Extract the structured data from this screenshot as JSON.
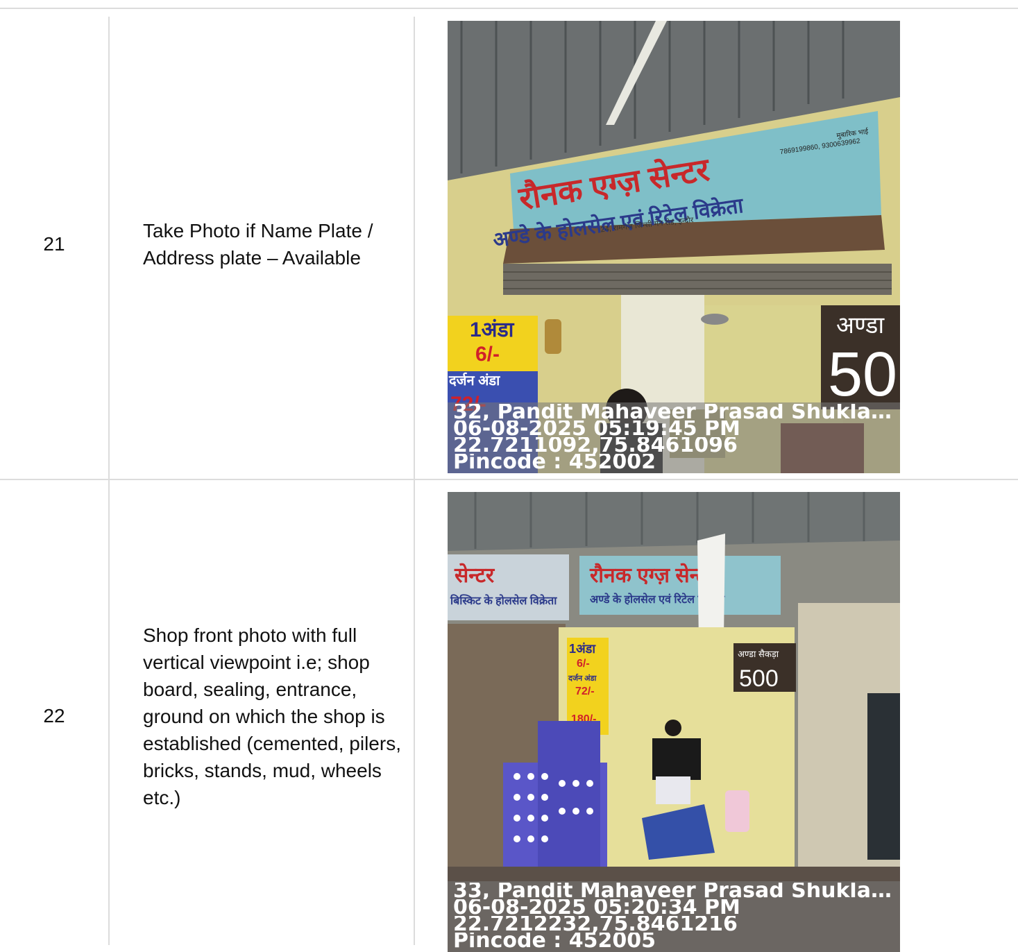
{
  "rows": [
    {
      "number": "21",
      "description": "Take Photo if Name Plate / Address plate – Available",
      "photo": {
        "sign_main": "रौनक एग्ज़ सेन्टर",
        "sign_sub": "अण्डे के होलसेल एवं रिटेल विक्रेता",
        "sign_addr": "24, रामगंज जिन्सी मेन रोड, इन्दौर",
        "sign_phone": "7869199860, 9300639962",
        "sign_owner": "मुबारिक भाई",
        "board_1": "1अंडा",
        "board_2": "6/-",
        "board_3": "दर्जन अंडा",
        "board_4": "72/-",
        "chalk": "अण्डा",
        "chalk_num": "50",
        "address": "32, Pandit Mahaveer Prasad Shukla Marg, ...",
        "datetime": "06-08-2025 05:19:45 PM",
        "coords": "22.7211092,75.8461096",
        "pincode": "Pincode : 452002"
      }
    },
    {
      "number": "22",
      "description": "Shop front photo with full vertical viewpoint i.e; shop board, sealing, entrance, ground on which the shop is established (cemented, pilers, bricks, stands, mud, wheels etc.)",
      "photo": {
        "sign_main": "रौनक एग्ज़ सेन्टर",
        "sign_sub": "अण्डे के होलसेल एवं रिटेल विक्रेता",
        "left_sign": "बिस्किट के होलसेल विक्रेता",
        "board_1": "1अंडा",
        "board_2": "6/-",
        "board_3": "दर्जन अंडा",
        "board_4": "72/-",
        "board_5": "180/-",
        "chalk": "अण्डा सैकड़ा",
        "chalk_num": "500",
        "address": "33, Pandit Mahaveer Prasad Shukla Marg, ...",
        "datetime": "06-08-2025 05:20:34 PM",
        "coords": "22.7212232,75.8461216",
        "pincode": "Pincode : 452005"
      }
    }
  ]
}
